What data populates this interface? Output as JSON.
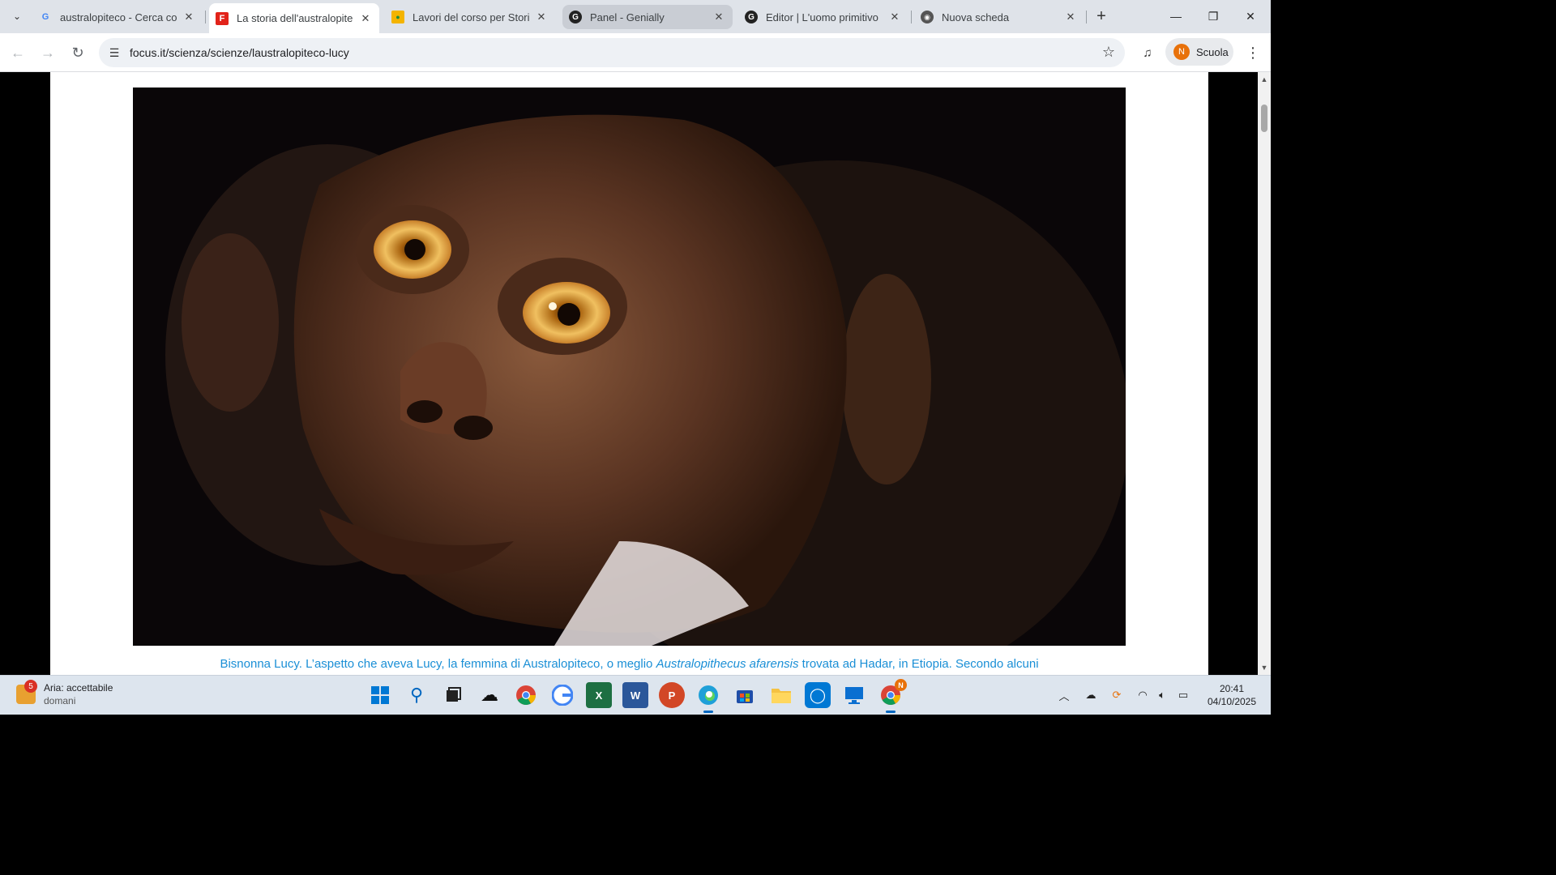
{
  "browser": {
    "tabs": [
      {
        "title": "australopiteco - Cerca con Google",
        "favicon": "google-g-icon",
        "active": false
      },
      {
        "title": "La storia dell'australopiteco Lucy",
        "favicon": "focus-f-icon",
        "active": true
      },
      {
        "title": "Lavori del corso per Storia",
        "favicon": "classroom-icon",
        "active": false
      },
      {
        "title": "Panel - Genially",
        "favicon": "genially-icon",
        "active": false
      },
      {
        "title": "Editor | L'uomo primitivo",
        "favicon": "genially-icon",
        "active": false
      },
      {
        "title": "Nuova scheda",
        "favicon": "chrome-icon",
        "active": false
      }
    ],
    "address": "focus.it/scienza/scienze/laustralopiteco-lucy",
    "profile": {
      "initial": "N",
      "label": "Scuola"
    }
  },
  "page": {
    "caption_start": "Bisnonna Lucy. L’aspetto che aveva Lucy, la femmina di Australopiteco, o meglio ",
    "caption_italic": "Australopithecus afarensis",
    "caption_end": " trovata ad Hadar, in Etiopia. Secondo alcuni"
  },
  "taskbar": {
    "weather_badge": "5",
    "weather_title": "Aria: accettabile",
    "weather_sub": "domani",
    "time": "20:41",
    "date": "04/10/2025",
    "chrome_badge": "N"
  },
  "colors": {
    "caption": "#1a8fd6",
    "active_tab": "#ffffff",
    "tabbar": "#dfe3e9"
  }
}
